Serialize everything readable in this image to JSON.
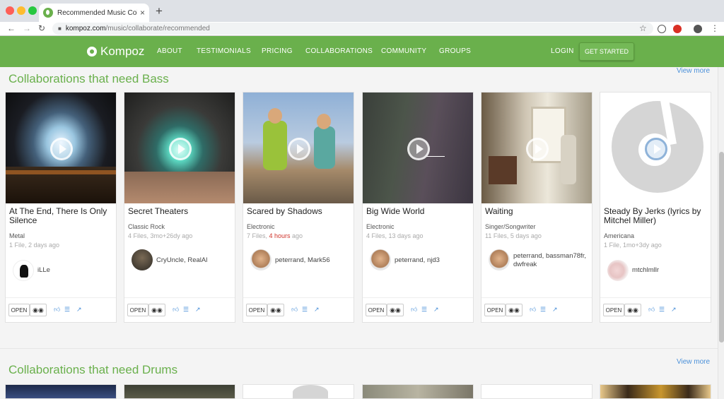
{
  "browser": {
    "tab_title": "Recommended Music Collabora",
    "tab_close": "×",
    "new_tab": "+",
    "back": "←",
    "forward": "→",
    "reload": "↻",
    "url_host": "kompoz.com",
    "url_path": "/music/collaborate/recommended",
    "star": "☆",
    "menu": "⋮"
  },
  "site": {
    "logo": "Kompoz",
    "nav": [
      "ABOUT",
      "TESTIMONIALS",
      "PRICING",
      "COLLABORATIONS",
      "COMMUNITY",
      "GROUPS"
    ],
    "login": "LOGIN",
    "get_started": "GET STARTED"
  },
  "sections": [
    {
      "title": "Collaborations that need Bass",
      "view_more": "View more",
      "cards": [
        {
          "title": "At The End, There Is Only Silence",
          "genre": "Metal",
          "meta": "1 File, 2 days ago",
          "members": "iLLe"
        },
        {
          "title": "Secret Theaters",
          "genre": "Classic Rock",
          "meta": "4 Files, 3mo+26dy ago",
          "members": "CryUncle, RealAl"
        },
        {
          "title": "Scared by Shadows",
          "genre": "Electronic",
          "meta_prefix": "7 Files, ",
          "meta_hot": "4 hours",
          "meta_suffix": " ago",
          "members": "peterrand, Mark56"
        },
        {
          "title": "Big Wide World",
          "genre": "Electronic",
          "meta": "4 Files, 13 days ago",
          "members": "peterrand, njd3"
        },
        {
          "title": "Waiting",
          "genre": "Singer/Songwriter",
          "meta": "11 Files, 5 days ago",
          "members": "peterrand, bassman78fr, dwfreak"
        },
        {
          "title": "Steady By Jerks (lyrics by Mitchel Miller)",
          "genre": "Americana",
          "meta": "1 File, 1mo+3dy ago",
          "members": "mtchlmllr"
        }
      ]
    },
    {
      "title": "Collaborations that need Drums",
      "view_more": "View more"
    }
  ],
  "card_actions": {
    "open": "OPEN",
    "find_icon": "binoculars-icon",
    "like_icon": "thumbs-up-icon",
    "list_icon": "list-icon",
    "share_icon": "external-link-icon"
  },
  "colors": {
    "brand_green": "#6ab04c",
    "link_blue": "#4a90d9",
    "hot_red": "#d0342c"
  }
}
